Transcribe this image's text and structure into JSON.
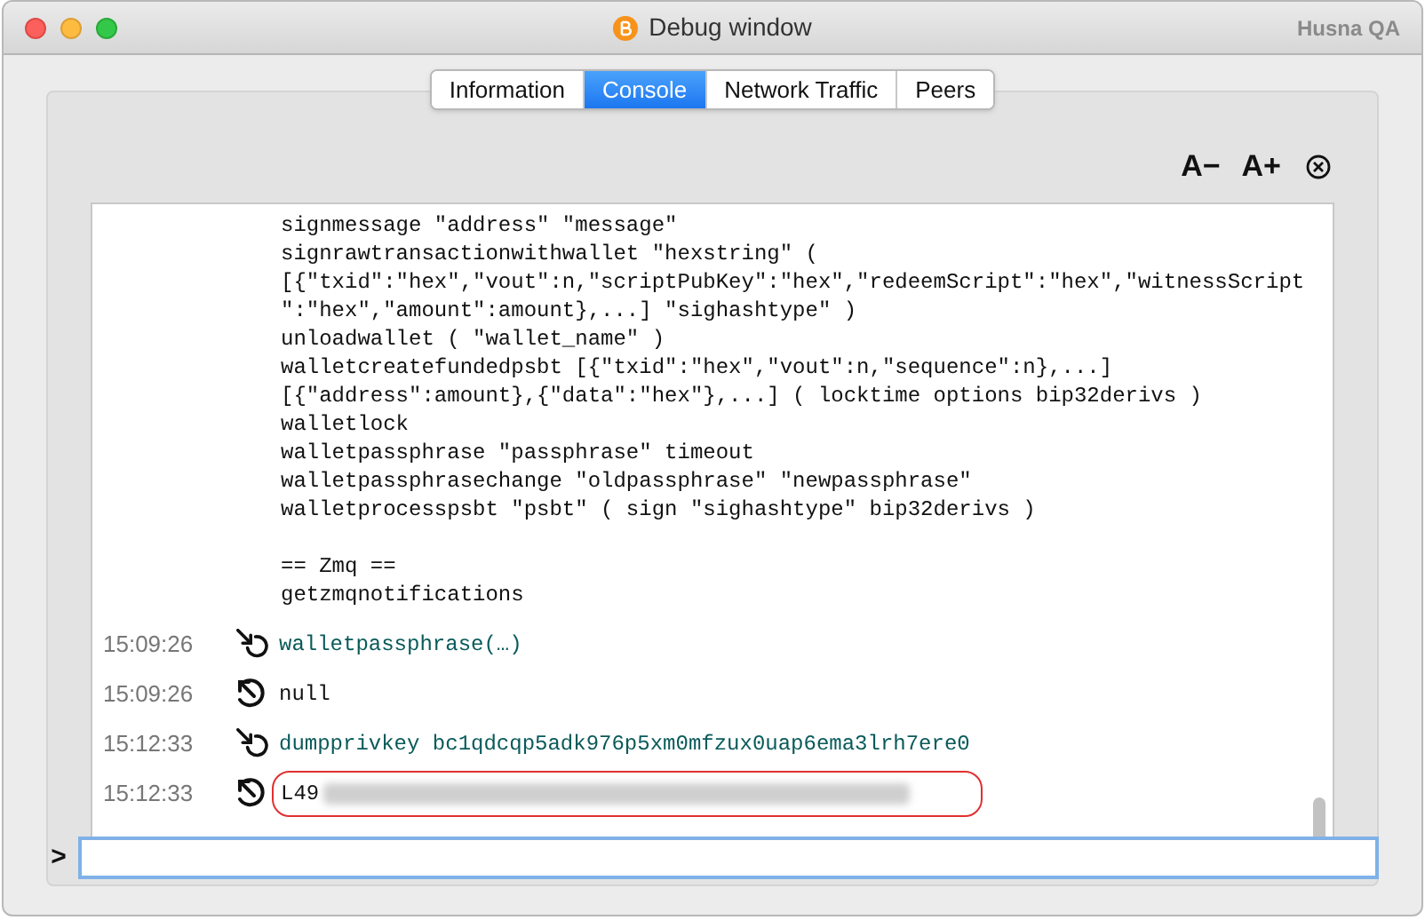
{
  "window": {
    "title": "Debug window",
    "user": "Husna QA"
  },
  "tabs": [
    {
      "label": "Information",
      "selected": false
    },
    {
      "label": "Console",
      "selected": true
    },
    {
      "label": "Network Traffic",
      "selected": false
    },
    {
      "label": "Peers",
      "selected": false
    }
  ],
  "font_buttons": [
    "A−",
    "A+"
  ],
  "help_sections": [
    {
      "lines": [
        "signmessage \"address\" \"message\"",
        "signrawtransactionwithwallet \"hexstring\" (",
        "[{\"txid\":\"hex\",\"vout\":n,\"scriptPubKey\":\"hex\",\"redeemScript\":\"hex\",\"witnessScript",
        "\":\"hex\",\"amount\":amount},...] \"sighashtype\" )",
        "unloadwallet ( \"wallet_name\" )",
        "walletcreatefundedpsbt [{\"txid\":\"hex\",\"vout\":n,\"sequence\":n},...]",
        "[{\"address\":amount},{\"data\":\"hex\"},...] ( locktime options bip32derivs )",
        "walletlock",
        "walletpassphrase \"passphrase\" timeout",
        "walletpassphrasechange \"oldpassphrase\" \"newpassphrase\"",
        "walletprocesspsbt \"psbt\" ( sign \"sighashtype\" bip32derivs )"
      ]
    },
    {
      "lines": [
        "== Zmq ==",
        "getzmqnotifications"
      ]
    }
  ],
  "entries": [
    {
      "time": "15:09:26",
      "kind": "command",
      "text": "walletpassphrase(…)",
      "highlighted": false,
      "redacted": false
    },
    {
      "time": "15:09:26",
      "kind": "reply",
      "text": "null",
      "highlighted": false,
      "redacted": false
    },
    {
      "time": "15:12:33",
      "kind": "command",
      "text": "dumpprivkey bc1qdcqp5adk976p5xm0mfzux0uap6ema3lrh7ere0",
      "highlighted": false,
      "redacted": false
    },
    {
      "time": "15:12:33",
      "kind": "reply",
      "text": "L49",
      "highlighted": true,
      "redacted": true
    }
  ],
  "prompt": ">"
}
